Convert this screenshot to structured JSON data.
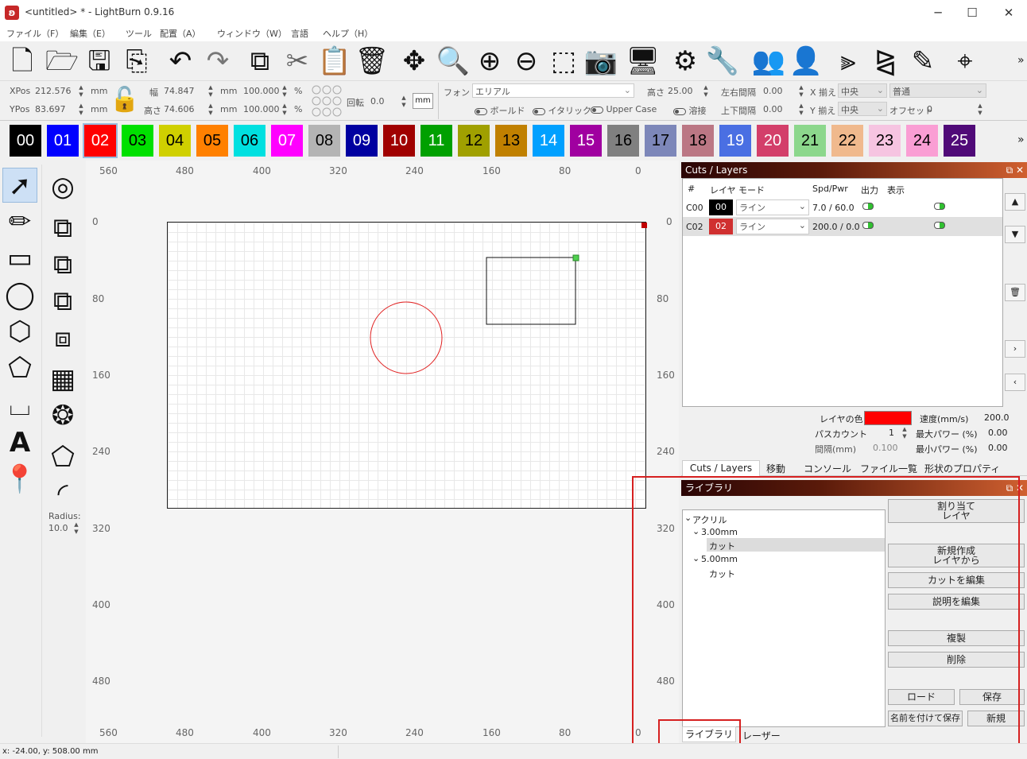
{
  "window": {
    "title": "<untitled> * - LightBurn 0.9.16",
    "minimize": "─",
    "maximize": "☐",
    "close": "✕"
  },
  "menu": [
    "ファイル（F）",
    "編集（E）",
    "ツール",
    "配置（A）",
    "ウィンドウ（W）",
    "言語",
    "ヘルプ（H）"
  ],
  "toolbar": {
    "icons": [
      "new-file-icon",
      "open-folder-icon",
      "save-icon",
      "import-icon",
      "undo-icon",
      "redo-icon",
      "copy-icon",
      "cut-icon",
      "paste-icon",
      "delete-icon",
      "move-icon",
      "zoom-page-icon",
      "zoom-in-icon",
      "zoom-out-icon",
      "frame-select-icon",
      "camera-icon",
      "monitor-icon",
      "settings-icon",
      "tools-icon",
      "group-icon",
      "user-icon",
      "align-icon",
      "mirror-icon",
      "pen-icon",
      "target-icon"
    ],
    "more": "»"
  },
  "props": {
    "xpos_label": "XPos",
    "xpos_value": "212.576",
    "ypos_label": "YPos",
    "ypos_value": "83.697",
    "unit": "mm",
    "width_label": "幅",
    "width_value": "74.847",
    "height_label": "高さ",
    "height_value": "74.606",
    "scale_x": "100.000",
    "scale_y": "100.000",
    "percent": "%",
    "rotate_label": "回転",
    "rotate_value": "0.0",
    "mm_button": "mm",
    "font_label": "フォント",
    "font_value": "エリアル",
    "height2_label": "高さ",
    "height2_value": "25.00",
    "hspace_label": "左右間隔",
    "hspace_value": "0.00",
    "xalign_label": "X 揃え",
    "xalign_value": "中央",
    "style_value": "普通",
    "bold": "ボールド",
    "italic": "イタリック",
    "upper": "Upper Case",
    "weld": "溶接",
    "vspace_label": "上下間隔",
    "vspace_value": "0.00",
    "yalign_label": "Y 揃え",
    "yalign_value": "中央",
    "offset_label": "オフセット",
    "offset_value": "0"
  },
  "palette": [
    {
      "label": "00",
      "bg": "#000000",
      "fg": "#ffffff"
    },
    {
      "label": "01",
      "bg": "#0000ff",
      "fg": "#ffffff"
    },
    {
      "label": "02",
      "bg": "#ff0000",
      "fg": "#ffffff"
    },
    {
      "label": "03",
      "bg": "#00e000",
      "fg": "#000000"
    },
    {
      "label": "04",
      "bg": "#d0d000",
      "fg": "#000000"
    },
    {
      "label": "05",
      "bg": "#ff8000",
      "fg": "#000000"
    },
    {
      "label": "06",
      "bg": "#00e0e0",
      "fg": "#000000"
    },
    {
      "label": "07",
      "bg": "#ff00ff",
      "fg": "#ffffff"
    },
    {
      "label": "08",
      "bg": "#b4b4b4",
      "fg": "#000000"
    },
    {
      "label": "09",
      "bg": "#0000a0",
      "fg": "#ffffff"
    },
    {
      "label": "10",
      "bg": "#a00000",
      "fg": "#ffffff"
    },
    {
      "label": "11",
      "bg": "#00a000",
      "fg": "#ffffff"
    },
    {
      "label": "12",
      "bg": "#a0a000",
      "fg": "#000000"
    },
    {
      "label": "13",
      "bg": "#c08000",
      "fg": "#000000"
    },
    {
      "label": "14",
      "bg": "#00a0ff",
      "fg": "#ffffff"
    },
    {
      "label": "15",
      "bg": "#a000a0",
      "fg": "#ffffff"
    },
    {
      "label": "16",
      "bg": "#808080",
      "fg": "#000000"
    },
    {
      "label": "17",
      "bg": "#7d87b9",
      "fg": "#000000"
    },
    {
      "label": "18",
      "bg": "#bb7784",
      "fg": "#000000"
    },
    {
      "label": "19",
      "bg": "#4a6fe3",
      "fg": "#ffffff"
    },
    {
      "label": "20",
      "bg": "#d33f6a",
      "fg": "#ffffff"
    },
    {
      "label": "21",
      "bg": "#8cd78c",
      "fg": "#000000"
    },
    {
      "label": "22",
      "bg": "#f0b98d",
      "fg": "#000000"
    },
    {
      "label": "23",
      "bg": "#f6c4e1",
      "fg": "#000000"
    },
    {
      "label": "24",
      "bg": "#fa9ed4",
      "fg": "#000000"
    },
    {
      "label": "25",
      "bg": "#500a78",
      "fg": "#ffffff"
    }
  ],
  "palette_more": "»",
  "lefttools": {
    "icons": [
      "select-arrow-icon",
      "pencil-icon",
      "rectangle-icon",
      "ellipse-icon",
      "polygon-icon",
      "pentagon-icon",
      "frame-text-icon",
      "text-icon",
      "position-marker-icon"
    ],
    "icons2": [
      "offset-icon",
      "weld-icon",
      "union-icon",
      "subtract-icon",
      "intersect-icon",
      "grid-array-icon",
      "circular-array-icon",
      "node-edit-icon",
      "corner-radius-icon"
    ],
    "radius_label": "Radius:",
    "radius_value": "10.0"
  },
  "ruler": {
    "top": [
      "560",
      "480",
      "400",
      "320",
      "240",
      "160",
      "80",
      "0"
    ],
    "bottom": [
      "560",
      "480",
      "400",
      "320",
      "240",
      "160",
      "80",
      "0"
    ],
    "left": [
      "0",
      "80",
      "160",
      "240",
      "320",
      "400",
      "480"
    ],
    "right": [
      "0",
      "80",
      "160",
      "240",
      "320",
      "400",
      "480"
    ]
  },
  "layers": {
    "title": "Cuts / Layers",
    "headers": [
      "#",
      "レイヤ",
      "モード",
      "Spd/Pwr",
      "出力",
      "表示"
    ],
    "rows": [
      {
        "id": "C00",
        "layer": "00",
        "color": "#000000",
        "mode": "ライン",
        "spdpwr": "7.0 / 60.0"
      },
      {
        "id": "C02",
        "layer": "02",
        "color": "#d03030",
        "mode": "ライン",
        "spdpwr": "200.0 / 0.0"
      }
    ],
    "layer_color_label": "レイヤの色",
    "layer_color": "#ff0000",
    "speed_label": "速度(mm/s)",
    "speed_value": "200.0",
    "pass_label": "パスカウント",
    "pass_value": "1",
    "maxpower_label": "最大パワー (%)",
    "maxpower_value": "0.00",
    "interval_label": "間隔(mm)",
    "interval_value": "0.100",
    "minpower_label": "最小パワー (%)",
    "minpower_value": "0.00",
    "tabs": [
      "Cuts / Layers",
      "移動",
      "コンソール",
      "ファイル一覧",
      "形状のプロパティ"
    ]
  },
  "library": {
    "title": "ライブラリ",
    "tree": [
      {
        "label": "アクリル",
        "depth": 0,
        "expander": "v"
      },
      {
        "label": "3.00mm",
        "depth": 1,
        "expander": "v"
      },
      {
        "label": "カット",
        "depth": 2,
        "expander": "",
        "selected": true
      },
      {
        "label": "5.00mm",
        "depth": 1,
        "expander": "v"
      },
      {
        "label": "カット",
        "depth": 2,
        "expander": ""
      }
    ],
    "assign": "割り当て\nレイヤ",
    "new_from_layer": "新規作成\nレイヤから",
    "edit_cut": "カットを編集",
    "edit_desc": "説明を編集",
    "duplicate": "複製",
    "delete": "削除",
    "load": "ロード",
    "save": "保存",
    "save_as": "名前を付けて保存",
    "new": "新規",
    "tabs": [
      "ライブラリ",
      "レーザー"
    ]
  },
  "status": {
    "coords": "x: -24.00, y: 508.00 mm"
  }
}
